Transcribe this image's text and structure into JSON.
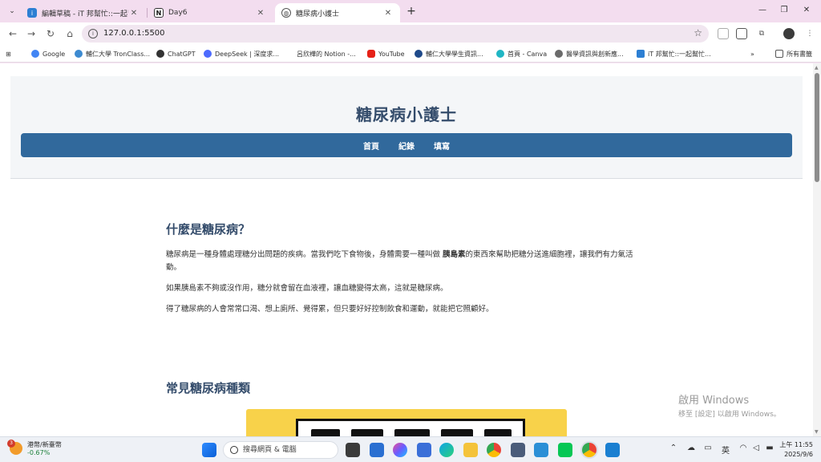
{
  "browser": {
    "tabs": [
      {
        "title": "編輯草稿 - iT 邦幫忙::一起幫忙解決難題",
        "active": false
      },
      {
        "title": "Day6",
        "active": false
      },
      {
        "title": "糖尿病小護士",
        "active": true
      }
    ],
    "url": "127.0.0.1:5500",
    "bookmarks": [
      "Google",
      "輔仁大學 TronClass...",
      "ChatGPT",
      "DeepSeek | 深度求...",
      "呂欣樺的 Notion -...",
      "YouTube",
      "輔仁大學學生資訊...",
      "首頁 - Canva",
      "醫學資訊與創新應...",
      "iT 邦幫忙::一起幫忙...",
      "所有書籤"
    ],
    "more_bookmarks": "»"
  },
  "page": {
    "site_title": "糖尿病小護士",
    "nav": [
      "首頁",
      "紀錄",
      "填寫"
    ],
    "section1": {
      "title": "什麼是糖尿病？",
      "p1_before": "糖尿病是一種身體處理糖分出問題的疾病。當我們吃下食物後，身體需要一種叫做 ",
      "p1_bold": "胰島素",
      "p1_after": "的東西來幫助把糖分送進細胞裡，讓我們有力氣活動。",
      "p2": "如果胰島素不夠或沒作用，糖分就會留在血液裡，讓血糖變得太高，這就是糖尿病。",
      "p3": "得了糖尿病的人會常常口渴、想上廁所、覺得累，但只要好好控制飲食和運動，就能把它照顧好。"
    },
    "section2": {
      "title": "常見糖尿病種類"
    }
  },
  "watermark": {
    "line1": "啟用 Windows",
    "line2": "移至 [設定] 以啟用 Windows。"
  },
  "taskbar": {
    "weather_badge": "3",
    "weather_title": "港幣/新臺幣",
    "weather_change": "-0.67%",
    "search_placeholder": "搜尋網頁 & 電腦",
    "ime": "英",
    "time": "上午 11:55",
    "date": "2025/9/6"
  },
  "colors": {
    "accent": "#31699c",
    "title": "#344c6b"
  }
}
